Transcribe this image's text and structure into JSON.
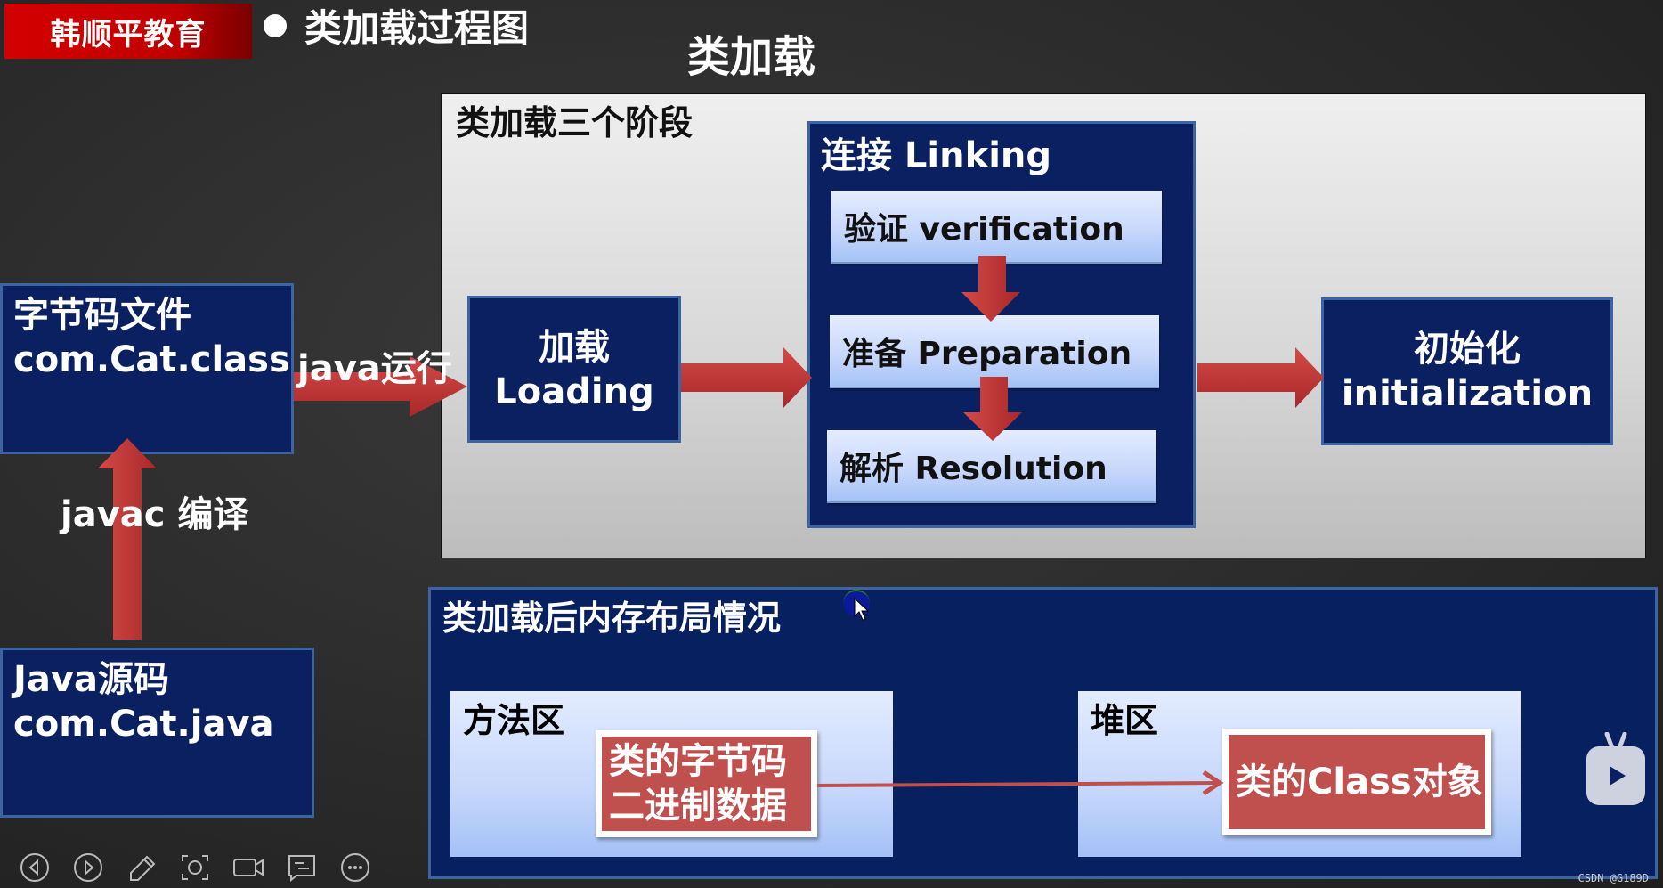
{
  "header": {
    "logo_text": "韩顺平教育",
    "slide_title": "类加载过程图",
    "section_heading": "类加载"
  },
  "left_column": {
    "bytecode_file": {
      "line1": "字节码文件",
      "line2": "com.Cat.class"
    },
    "java_source": {
      "line1": "Java源码",
      "line2": "com.Cat.java"
    },
    "javac_label": "javac 编译",
    "java_run_label": "java运行"
  },
  "stages_panel": {
    "title": "类加载三个阶段",
    "loading": {
      "line1": "加载",
      "line2": "Loading"
    },
    "linking": {
      "title": "连接 Linking",
      "steps": [
        {
          "label": "验证 verification"
        },
        {
          "label": "准备 Preparation"
        },
        {
          "label": "解析 Resolution"
        }
      ]
    },
    "initialization": {
      "line1": "初始化",
      "line2": "initialization"
    }
  },
  "memory_panel": {
    "title": "类加载后内存布局情况",
    "method_area": {
      "label": "方法区",
      "content_line1": "类的字节码",
      "content_line2": "二进制数据"
    },
    "heap": {
      "label": "堆区",
      "content": "类的Class对象"
    }
  },
  "colors": {
    "navy": "#0a2060",
    "navy_border": "#3b64a0",
    "arrow_red": "#c0393b",
    "logo_red": "#d40000",
    "object_red": "#c0504d"
  },
  "toolbar": {
    "buttons": [
      {
        "icon": "previous-icon"
      },
      {
        "icon": "next-icon"
      },
      {
        "icon": "pen-icon"
      },
      {
        "icon": "screenshot-icon"
      },
      {
        "icon": "camera-icon"
      },
      {
        "icon": "comment-icon"
      },
      {
        "icon": "more-icon"
      }
    ]
  },
  "watermark": "CSDN @G189D"
}
